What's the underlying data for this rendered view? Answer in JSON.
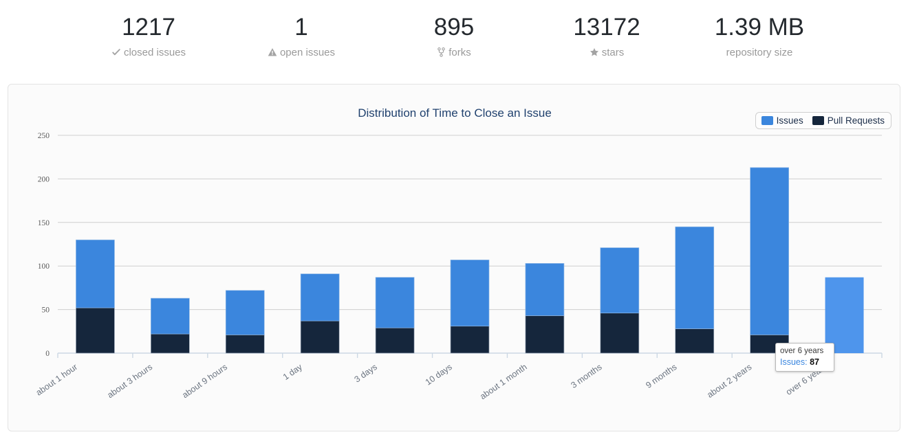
{
  "stats": [
    {
      "value": "1217",
      "label": "closed issues",
      "icon": "check-icon"
    },
    {
      "value": "1",
      "label": "open issues",
      "icon": "warning-triangle-icon"
    },
    {
      "value": "895",
      "label": "forks",
      "icon": "fork-icon"
    },
    {
      "value": "13172",
      "label": "stars",
      "icon": "star-icon"
    },
    {
      "value": "1.39 MB",
      "label": "repository size",
      "icon": "none"
    }
  ],
  "chart_panel": {
    "title": "Distribution of Time to Close an Issue",
    "legend": [
      {
        "label": "Issues",
        "color": "#3b86dd"
      },
      {
        "label": "Pull Requests",
        "color": "#15263c"
      }
    ]
  },
  "tooltip": {
    "title": "over 6 years",
    "key": "Issues:",
    "value": "87"
  },
  "chart_data": {
    "type": "bar",
    "stacked": true,
    "title": "Distribution of Time to Close an Issue",
    "xlabel": "",
    "ylabel": "",
    "ylim": [
      0,
      250
    ],
    "yticks": [
      0,
      50,
      100,
      150,
      200,
      250
    ],
    "grid": true,
    "legend_position": "top-right",
    "categories": [
      "about 1 hour",
      "about 3 hours",
      "about 9 hours",
      "1 day",
      "3 days",
      "10 days",
      "about 1 month",
      "3 months",
      "9 months",
      "about 2 years",
      "over 6 years"
    ],
    "series": [
      {
        "name": "Pull Requests",
        "color": "#15263c",
        "values": [
          52,
          22,
          21,
          37,
          29,
          31,
          43,
          46,
          28,
          21,
          0
        ]
      },
      {
        "name": "Issues",
        "color": "#3b86dd",
        "values": [
          78,
          41,
          51,
          54,
          58,
          76,
          60,
          75,
          117,
          192,
          87
        ]
      }
    ],
    "totals": [
      130,
      63,
      72,
      91,
      87,
      107,
      103,
      121,
      145,
      213,
      87
    ],
    "highlighted_category": "over 6 years",
    "highlight_color": "#4e95ec"
  }
}
